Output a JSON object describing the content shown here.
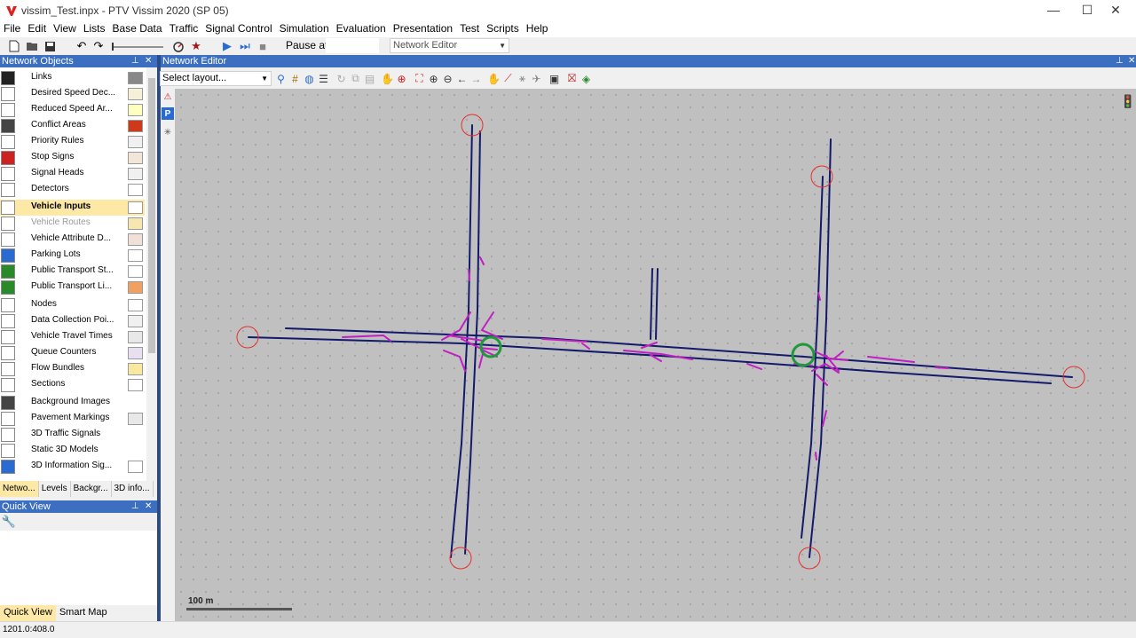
{
  "window": {
    "title": "vissim_Test.inpx - PTV Vissim 2020 (SP 05)",
    "minimize": "—",
    "maximize": "☐",
    "close": "✕"
  },
  "menu": [
    "File",
    "Edit",
    "View",
    "Lists",
    "Base Data",
    "Traffic",
    "Signal Control",
    "Simulation",
    "Evaluation",
    "Presentation",
    "Test",
    "Scripts",
    "Help"
  ],
  "toolbar": {
    "pause_label": "Pause at:",
    "pause_value": "",
    "editor_select": "Network Editor"
  },
  "network_objects": {
    "header": "Network Objects",
    "items": [
      {
        "label": "Links",
        "icon": "links-icon",
        "icon_bg": "#222222",
        "swatch": "#888888"
      },
      {
        "label": "Desired Speed Dec...",
        "icon": "speed-sign-icon",
        "icon_bg": "#ffffff",
        "swatch": "#f5f0d8"
      },
      {
        "label": "Reduced Speed Ar...",
        "icon": "warning-triangle-icon",
        "icon_bg": "#ffffff",
        "swatch": "#ffffc0"
      },
      {
        "label": "Conflict Areas",
        "icon": "conflict-areas-icon",
        "icon_bg": "#444444",
        "swatch": "#cc3a1a"
      },
      {
        "label": "Priority Rules",
        "icon": "priority-rules-icon",
        "icon_bg": "#ffffff",
        "swatch": "#f0f0f0"
      },
      {
        "label": "Stop Signs",
        "icon": "stop-sign-icon",
        "icon_bg": "#cc2222",
        "swatch": "#f3e6d8"
      },
      {
        "label": "Signal Heads",
        "icon": "signal-head-icon",
        "icon_bg": "#ffffff",
        "swatch": "#f0f0f0"
      },
      {
        "label": "Detectors",
        "icon": "detector-icon",
        "icon_bg": "#ffffff",
        "swatch": "#ffffff"
      },
      {
        "label": "Vehicle Inputs",
        "icon": "vehicle-inputs-icon",
        "icon_bg": "#ffffff",
        "swatch": "#ffffff"
      },
      {
        "label": "Vehicle Routes",
        "icon": "vehicle-routes-icon",
        "icon_bg": "#ffffff",
        "swatch": "#f8e6b0"
      },
      {
        "label": "Vehicle Attribute D...",
        "icon": "vehicle-attribute-icon",
        "icon_bg": "#ffffff",
        "swatch": "#f0e0d8"
      },
      {
        "label": "Parking Lots",
        "icon": "parking-icon",
        "icon_bg": "#2a6bd1",
        "swatch": "#ffffff"
      },
      {
        "label": "Public Transport St...",
        "icon": "pt-stop-icon",
        "icon_bg": "#2a8a2a",
        "swatch": "#ffffff"
      },
      {
        "label": "Public Transport Li...",
        "icon": "pt-line-icon",
        "icon_bg": "#2a8a2a",
        "swatch": "#f0a060"
      },
      {
        "label": "Nodes",
        "icon": "nodes-icon",
        "icon_bg": "#ffffff",
        "swatch": "#ffffff"
      },
      {
        "label": "Data Collection Poi...",
        "icon": "data-collection-icon",
        "icon_bg": "#ffffff",
        "swatch": "#f0f0f0"
      },
      {
        "label": "Vehicle Travel Times",
        "icon": "travel-time-icon",
        "icon_bg": "#ffffff",
        "swatch": "#e8e8e8"
      },
      {
        "label": "Queue Counters",
        "icon": "queue-counter-icon",
        "icon_bg": "#ffffff",
        "swatch": "#e8e0f0"
      },
      {
        "label": "Flow Bundles",
        "icon": "flow-bundle-icon",
        "icon_bg": "#ffffff",
        "swatch": "#f8e8a0"
      },
      {
        "label": "Sections",
        "icon": "sections-icon",
        "icon_bg": "#ffffff",
        "swatch": "#ffffff"
      },
      {
        "label": "Background Images",
        "icon": "background-image-icon",
        "icon_bg": "#444444",
        "swatch": ""
      },
      {
        "label": "Pavement Markings",
        "icon": "pavement-icon",
        "icon_bg": "#ffffff",
        "swatch": "#e8e8e8"
      },
      {
        "label": "3D Traffic Signals",
        "icon": "3d-signal-icon",
        "icon_bg": "#ffffff",
        "swatch": ""
      },
      {
        "label": "Static 3D Models",
        "icon": "static-3d-icon",
        "icon_bg": "#ffffff",
        "swatch": ""
      },
      {
        "label": "3D Information Sig...",
        "icon": "info-sign-icon",
        "icon_bg": "#2a6bd1",
        "swatch": "#ffffff"
      }
    ],
    "tabs": [
      "Netwo...",
      "Levels",
      "Backgr...",
      "3D info..."
    ]
  },
  "quick_view": {
    "header": "Quick View",
    "tabs": [
      "Quick View",
      "Smart Map"
    ]
  },
  "editor": {
    "header": "Network Editor",
    "layout_select": "Select layout...",
    "scale_label": "100 m"
  },
  "status": {
    "coordinates": "1201.0:408.0"
  },
  "colors": {
    "link": "#141a6b",
    "connector": "#c21fc2",
    "vehicle_input_marker": "#e53030",
    "node_marker": "#1e9a3a",
    "panel_header": "#3c6fbf"
  }
}
